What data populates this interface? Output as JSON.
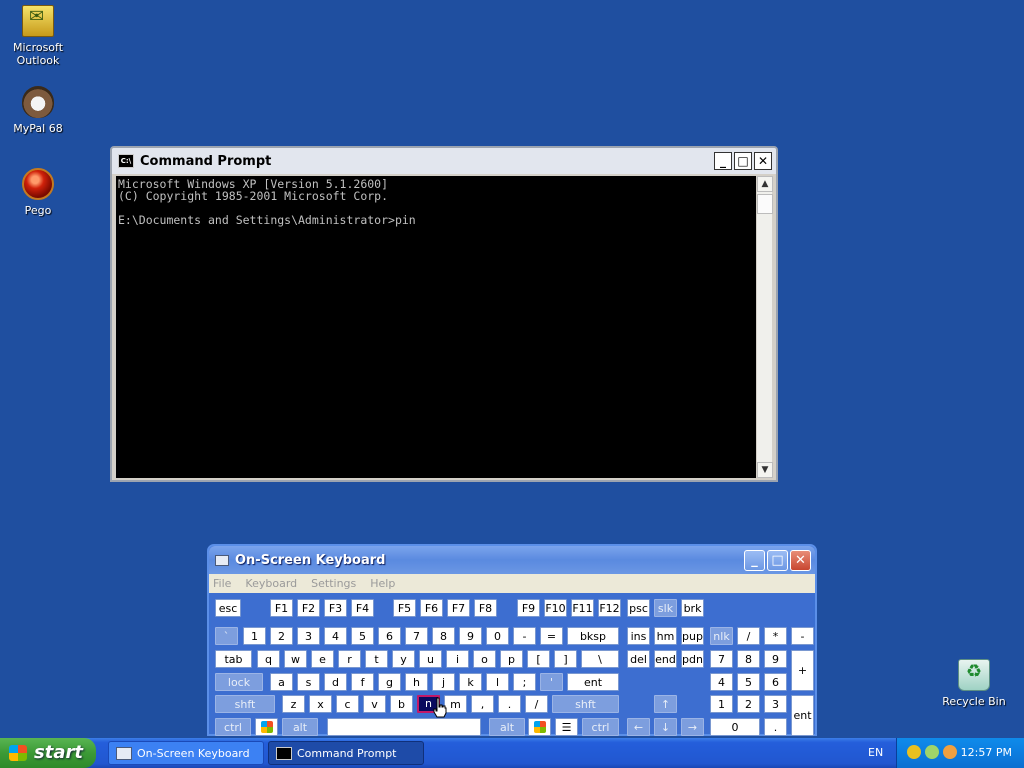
{
  "desktop": {
    "icons": [
      {
        "label": "Microsoft\nOutlook",
        "icon": "outlook-icon"
      },
      {
        "label": "MyPal 68",
        "icon": "mypal-icon"
      },
      {
        "label": "Pego",
        "icon": "pego-icon"
      },
      {
        "label": "Recycle Bin",
        "icon": "recycle-bin-icon"
      }
    ]
  },
  "cmd": {
    "title": "Command Prompt",
    "lines": [
      "Microsoft Windows XP [Version 5.1.2600]",
      "(C) Copyright 1985-2001 Microsoft Corp.",
      "",
      "E:\\Documents and Settings\\Administrator>pin"
    ]
  },
  "osk": {
    "title": "On-Screen Keyboard",
    "menu": [
      "File",
      "Keyboard",
      "Settings",
      "Help"
    ],
    "pressed_key": "n"
  },
  "taskbar": {
    "start": "start",
    "tasks": [
      "On-Screen Keyboard",
      "Command Prompt"
    ],
    "lang": "EN",
    "clock": "12:57 PM"
  }
}
